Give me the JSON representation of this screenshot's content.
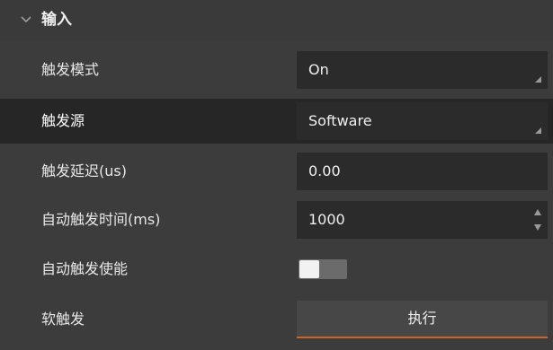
{
  "section": {
    "title": "输入",
    "icon": "chevron-down-icon"
  },
  "rows": {
    "trigger_mode": {
      "label": "触发模式",
      "value": "On"
    },
    "trigger_source": {
      "label": "触发源",
      "value": "Software"
    },
    "trigger_delay": {
      "label": "触发延迟(us)",
      "value": "0.00"
    },
    "auto_trigger_time": {
      "label": "自动触发时间(ms)",
      "value": "1000"
    },
    "auto_trigger_enable": {
      "label": "自动触发使能",
      "value": "off"
    },
    "soft_trigger": {
      "label": "软触发",
      "button": "执行"
    }
  },
  "colors": {
    "panel": "#3c3c3c",
    "selected_row": "#262626",
    "field": "#2b2b2b",
    "button": "#474747",
    "accent": "#c8682b"
  }
}
